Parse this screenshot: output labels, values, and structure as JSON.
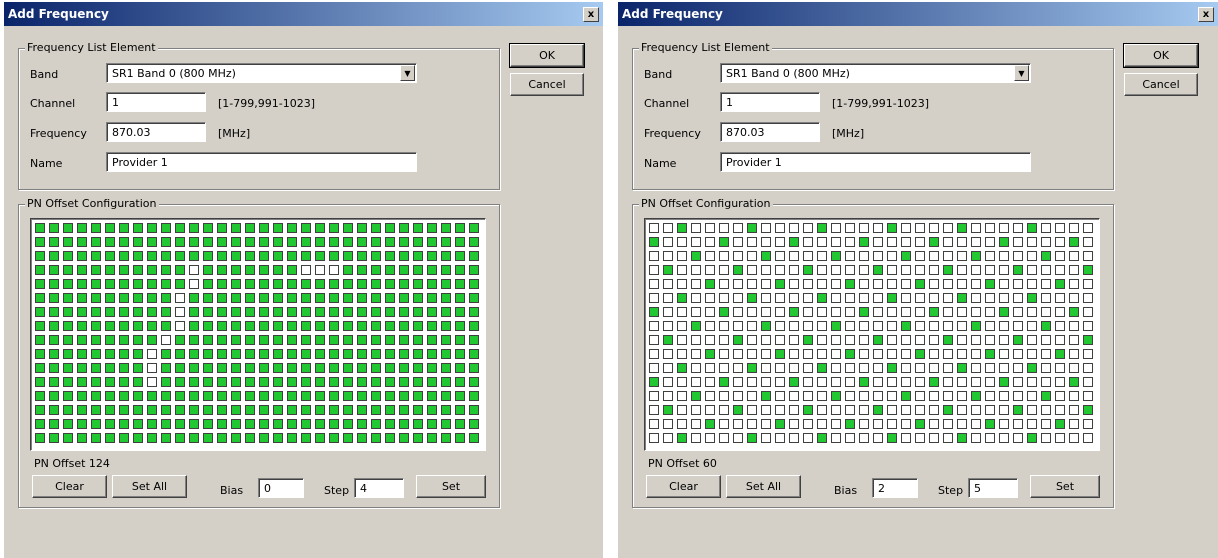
{
  "colors": {
    "active": "#22c832",
    "inactive": "#ffffff",
    "titlebar": "#0a246a"
  },
  "dialogs": [
    {
      "title": "Add Frequency",
      "close_glyph": "x",
      "freq_group_label": "Frequency List Element",
      "band_label": "Band",
      "band_value": "SR1 Band 0  (800 MHz)",
      "channel_label": "Channel",
      "channel_value": "1",
      "channel_range": "[1-799,991-1023]",
      "frequency_label": "Frequency",
      "frequency_value": "870.03",
      "frequency_unit": "[MHz]",
      "name_label": "Name",
      "name_value": "Provider 1",
      "ok_label": "OK",
      "cancel_label": "Cancel",
      "pn_group_label": "PN Offset Configuration",
      "pn_status": "PN Offset 124",
      "clear_label": "Clear",
      "set_all_label": "Set All",
      "bias_label": "Bias",
      "bias_value": "0",
      "step_label": "Step",
      "step_value": "4",
      "set_label": "Set",
      "grid": {
        "rows": 16,
        "cols": 32,
        "mode": "all_except",
        "off_cells": [
          [
            3,
            11
          ],
          [
            3,
            19
          ],
          [
            3,
            20
          ],
          [
            3,
            21
          ],
          [
            4,
            11
          ],
          [
            5,
            10
          ],
          [
            6,
            10
          ],
          [
            7,
            10
          ],
          [
            8,
            9
          ],
          [
            9,
            8
          ],
          [
            10,
            8
          ],
          [
            11,
            8
          ]
        ]
      }
    },
    {
      "title": "Add Frequency",
      "close_glyph": "x",
      "freq_group_label": "Frequency List Element",
      "band_label": "Band",
      "band_value": "SR1 Band 0  (800 MHz)",
      "channel_label": "Channel",
      "channel_value": "1",
      "channel_range": "[1-799,991-1023]",
      "frequency_label": "Frequency",
      "frequency_value": "870.03",
      "frequency_unit": "[MHz]",
      "name_label": "Name",
      "name_value": "Provider 1",
      "ok_label": "OK",
      "cancel_label": "Cancel",
      "pn_group_label": "PN Offset Configuration",
      "pn_status": "PN Offset 60",
      "clear_label": "Clear",
      "set_all_label": "Set All",
      "bias_label": "Bias",
      "bias_value": "2",
      "step_label": "Step",
      "step_value": "5",
      "set_label": "Set",
      "grid": {
        "rows": 16,
        "cols": 32,
        "mode": "bias_step",
        "bias": 2,
        "step": 5
      }
    }
  ]
}
